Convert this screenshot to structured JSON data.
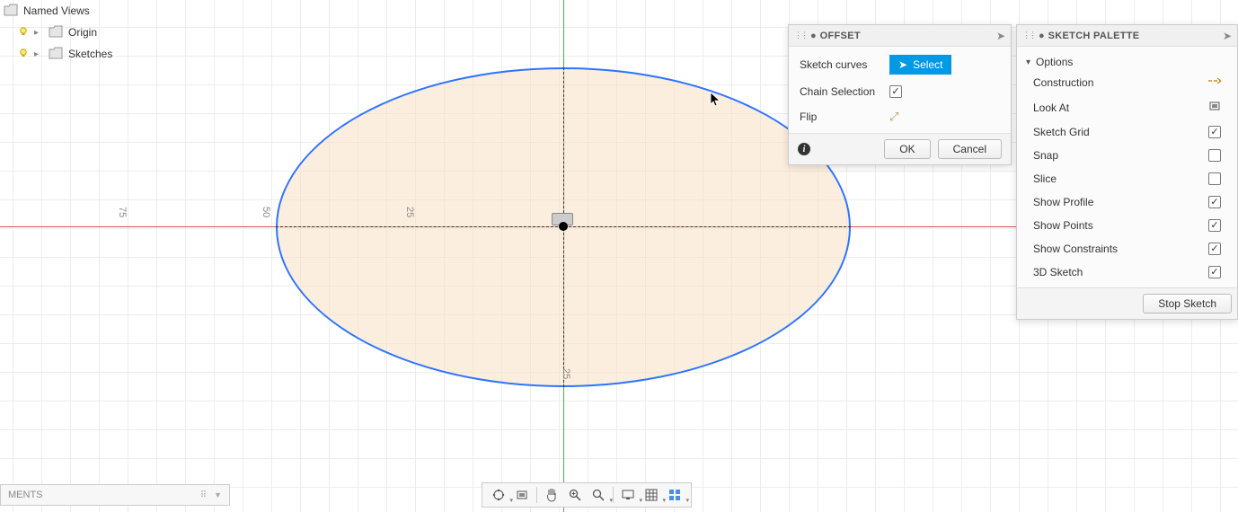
{
  "browser": {
    "named_views": "Named Views",
    "origin": "Origin",
    "sketches": "Sketches"
  },
  "axis_ticks": {
    "t75": "75",
    "t50": "50",
    "t25": "25",
    "t25b": "25"
  },
  "offset_panel": {
    "title": "OFFSET",
    "sketch_curves": "Sketch curves",
    "select_label": "Select",
    "chain_selection": "Chain Selection",
    "chain_checked": true,
    "flip": "Flip",
    "ok": "OK",
    "cancel": "Cancel"
  },
  "sketch_palette": {
    "title": "SKETCH PALETTE",
    "options_header": "Options",
    "options": {
      "construction": "Construction",
      "look_at": "Look At",
      "sketch_grid": "Sketch Grid",
      "sketch_grid_checked": true,
      "snap": "Snap",
      "snap_checked": false,
      "slice": "Slice",
      "slice_checked": false,
      "show_profile": "Show Profile",
      "show_profile_checked": true,
      "show_points": "Show Points",
      "show_points_checked": true,
      "show_constraints": "Show Constraints",
      "show_constraints_checked": true,
      "three_d_sketch": "3D Sketch",
      "three_d_sketch_checked": true
    },
    "stop_sketch": "Stop Sketch"
  },
  "comments_bar": {
    "label": "MENTS"
  }
}
